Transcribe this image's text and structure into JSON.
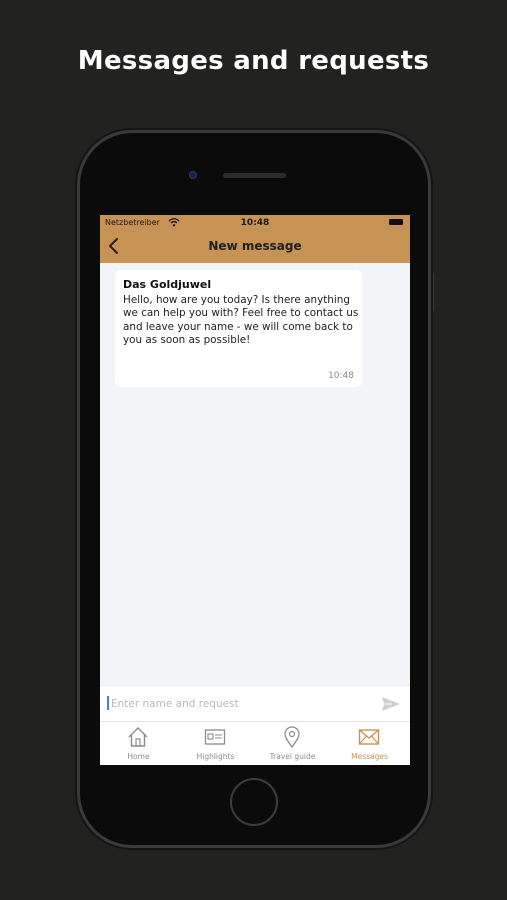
{
  "headline": "Messages and requests",
  "status_bar": {
    "carrier": "Netzbetreiber",
    "time": "10:48"
  },
  "header": {
    "title": "New message",
    "back_icon": "chevron-left-icon",
    "background": "#c79355"
  },
  "message": {
    "sender": "Das Goldjuwel",
    "text": "Hello, how are you today? Is there anything we can help you with? Feel free to contact us and leave your name - we will come back to you as soon as possible!",
    "time": "10:48"
  },
  "composer": {
    "placeholder": "Enter name and request",
    "value": "",
    "send_icon": "send-icon"
  },
  "tabs": [
    {
      "label": "Home",
      "icon": "home-icon",
      "active": false
    },
    {
      "label": "Highlights",
      "icon": "id-card-icon",
      "active": false
    },
    {
      "label": "Travel guide",
      "icon": "map-pin-icon",
      "active": false
    },
    {
      "label": "Messages",
      "icon": "envelope-icon",
      "active": true
    }
  ],
  "colors": {
    "accent": "#c79355",
    "background": "#222221",
    "screen": "#f2f4f7"
  }
}
